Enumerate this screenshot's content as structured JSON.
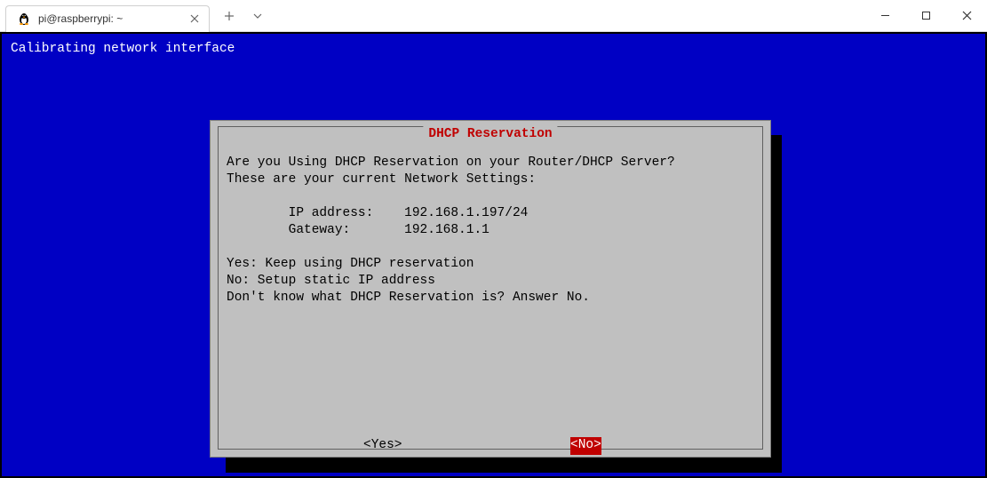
{
  "titlebar": {
    "tab_title": "pi@raspberrypi: ~",
    "tab_icon": "penguin-icon"
  },
  "terminal": {
    "status_line": "Calibrating network interface"
  },
  "dialog": {
    "title": " DHCP Reservation ",
    "line1": "Are you Using DHCP Reservation on your Router/DHCP Server?",
    "line2": "These are your current Network Settings:",
    "ip_label": "        IP address:    ",
    "ip_value": "192.168.1.197/24",
    "gw_label": "        Gateway:       ",
    "gw_value": "192.168.1.1",
    "opt_yes": "Yes: Keep using DHCP reservation",
    "opt_no": "No: Setup static IP address",
    "hint": "Don't know what DHCP Reservation is? Answer No.",
    "button_yes": "<Yes>",
    "button_no": "<No>"
  }
}
